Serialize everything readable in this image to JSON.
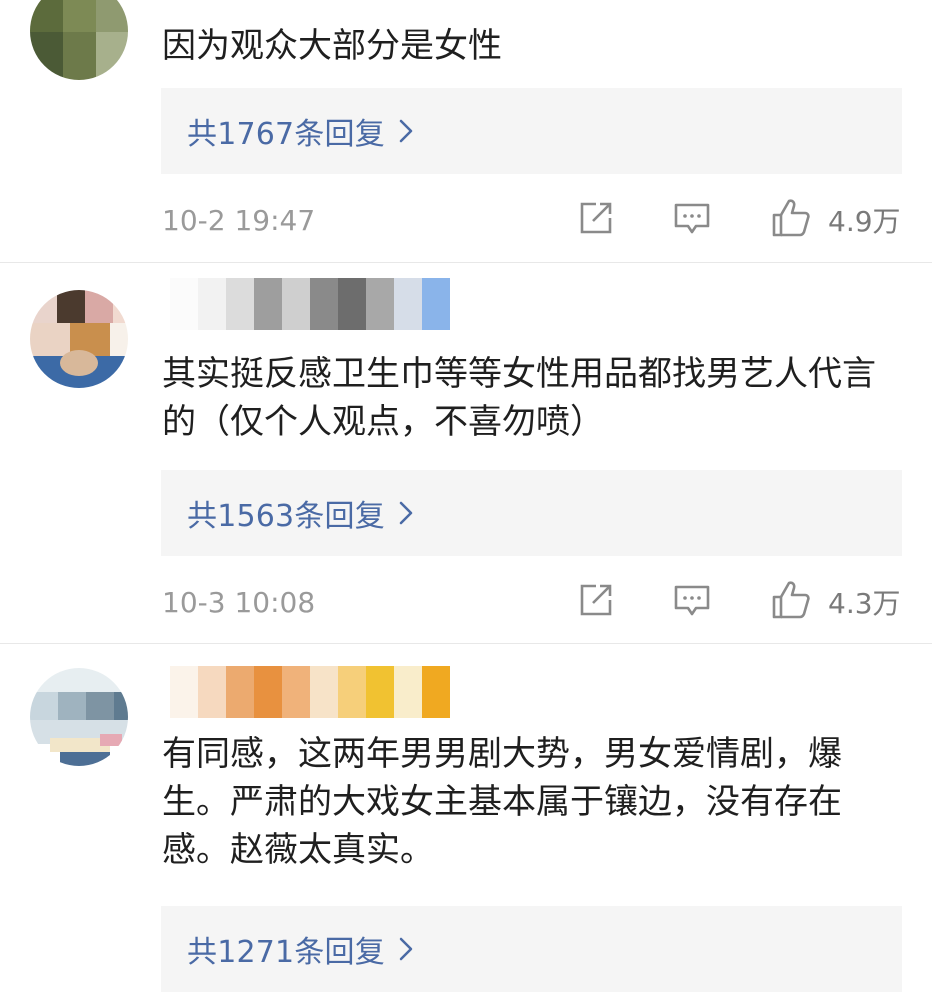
{
  "comments": [
    {
      "text": "因为观众大部分是女性",
      "reply_label": "共1767条回复",
      "timestamp": "10-2 19:47",
      "likes": "4.9万",
      "avatar_colors": [
        "#5c6b3c",
        "#7d8a55",
        "#8f9a70",
        "#4b5a36",
        "#6d7a4a",
        "#a7b08c"
      ],
      "username_colors": []
    },
    {
      "text": "其实挺反感卫生巾等等女性用品都找男艺人代言的（仅个人观点，不喜勿喷）",
      "reply_label": "共1563条回复",
      "timestamp": "10-3 10:08",
      "likes": "4.3万",
      "avatar_colors": [
        "#e9d4cc",
        "#4b3a2e",
        "#d9a9a5",
        "#f1dad0",
        "#ead3c4",
        "#c98f4d",
        "#f7f1ea",
        "#3c6aa6",
        "#d8b89a"
      ],
      "username_colors": [
        "#fbfbfb",
        "#f2f2f2",
        "#dcdcdc",
        "#9e9e9e",
        "#cfcfcf",
        "#8a8a8a",
        "#6d6d6d",
        "#a8a8a8",
        "#d6dde8",
        "#8ab4ea"
      ]
    },
    {
      "text": "有同感，这两年男男剧大势，男女爱情剧，爆生。严肃的大戏女主基本属于镶边，没有存在感。赵薇太真实。",
      "reply_label": "共1271条回复",
      "timestamp": "",
      "likes": "",
      "avatar_colors": [
        "#e7eef1",
        "#9fb3bf",
        "#c8d6de",
        "#7e94a3",
        "#5f7b90",
        "#d6e0e6",
        "#f2e6c9",
        "#4d6f95",
        "#e6a9b4"
      ],
      "username_colors": [
        "#fbf3ea",
        "#f6d9bf",
        "#ecaa6f",
        "#e8913f",
        "#f0b27a",
        "#f7e3c8",
        "#f6cf7a",
        "#f1c231",
        "#f9edcb",
        "#f0a921"
      ]
    }
  ]
}
